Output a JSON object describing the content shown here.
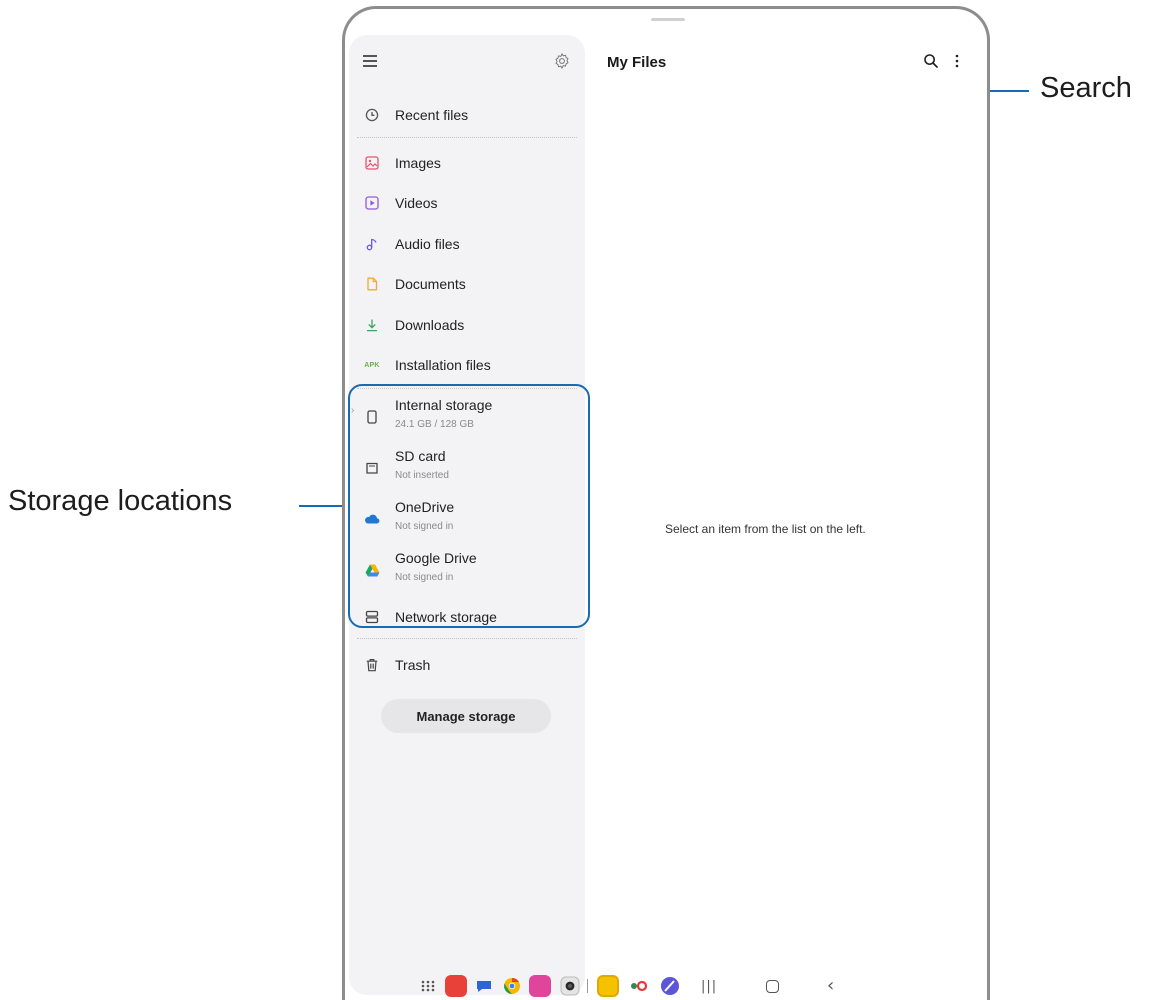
{
  "app": {
    "title": "My Files"
  },
  "sidebar": {
    "items": [
      {
        "label": "Recent files",
        "icon": "clock-icon"
      },
      {
        "label": "Images",
        "icon": "image-icon"
      },
      {
        "label": "Videos",
        "icon": "video-icon"
      },
      {
        "label": "Audio files",
        "icon": "music-note-icon"
      },
      {
        "label": "Documents",
        "icon": "document-icon"
      },
      {
        "label": "Downloads",
        "icon": "download-icon"
      },
      {
        "label": "Installation files",
        "icon": "apk-icon",
        "badge": "APK"
      }
    ],
    "storage": [
      {
        "label": "Internal storage",
        "sub": "24.1 GB / 128 GB",
        "icon": "phone-icon"
      },
      {
        "label": "SD card",
        "sub": "Not inserted",
        "icon": "sd-card-icon"
      },
      {
        "label": "OneDrive",
        "sub": "Not signed in",
        "icon": "onedrive-icon"
      },
      {
        "label": "Google Drive",
        "sub": "Not signed in",
        "icon": "google-drive-icon"
      },
      {
        "label": "Network storage",
        "icon": "network-storage-icon"
      }
    ],
    "trash": {
      "label": "Trash",
      "icon": "trash-icon"
    },
    "manage_button": "Manage storage"
  },
  "main": {
    "empty_message": "Select an item from the list on the left."
  },
  "callouts": {
    "search": "Search",
    "storage": "Storage locations"
  },
  "colors": {
    "accent": "#1a6ab0",
    "drawer_bg": "#f3f3f5",
    "apk_green": "#6ab04c"
  }
}
